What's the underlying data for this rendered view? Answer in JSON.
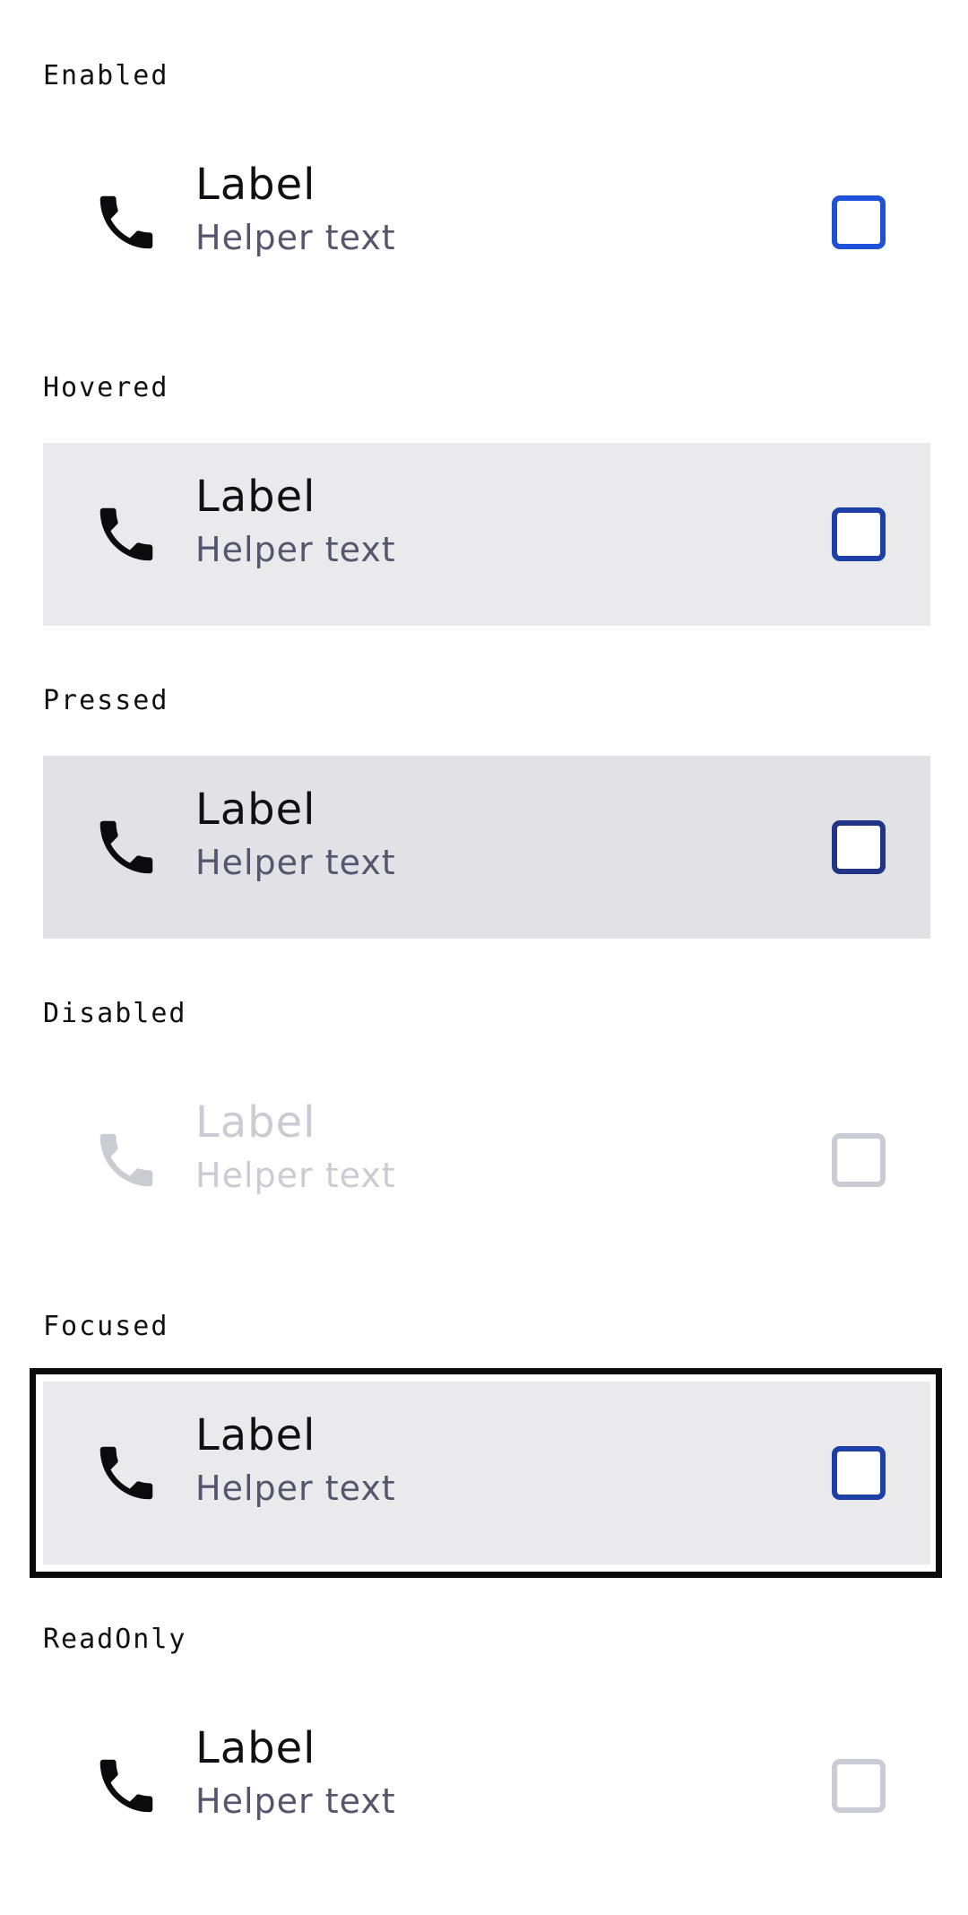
{
  "states": [
    {
      "key": "enabled",
      "title": "Enabled",
      "label": "Label",
      "helper": "Helper text",
      "background": "#ffffff",
      "checkbox_color": "#1f50d8",
      "icon_color": "#0b0b0d",
      "checked": false
    },
    {
      "key": "hovered",
      "title": "Hovered",
      "label": "Label",
      "helper": "Helper text",
      "background": "#eaeaed",
      "checkbox_color": "#1e3fa8",
      "icon_color": "#0b0b0d",
      "checked": false
    },
    {
      "key": "pressed",
      "title": "Pressed",
      "label": "Label",
      "helper": "Helper text",
      "background": "#e1e1e6",
      "checkbox_color": "#203585",
      "icon_color": "#0b0b0d",
      "checked": false
    },
    {
      "key": "disabled",
      "title": "Disabled",
      "label": "Label",
      "helper": "Helper text",
      "background": "#ffffff",
      "checkbox_color": "#cbcbd4",
      "icon_color": "#cbcbd4",
      "checked": false
    },
    {
      "key": "focused",
      "title": "Focused",
      "label": "Label",
      "helper": "Helper text",
      "background": "#eaeaed",
      "checkbox_color": "#1e3fa8",
      "icon_color": "#0b0b0d",
      "checked": false,
      "focus_ring_color": "#0b0b0d"
    },
    {
      "key": "readonly",
      "title": "ReadOnly",
      "label": "Label",
      "helper": "Helper text",
      "background": "#ffffff",
      "checkbox_color": "#cbcbd4",
      "icon_color": "#0b0b0d",
      "checked": false
    }
  ],
  "icons": {
    "leading": "phone-icon"
  }
}
